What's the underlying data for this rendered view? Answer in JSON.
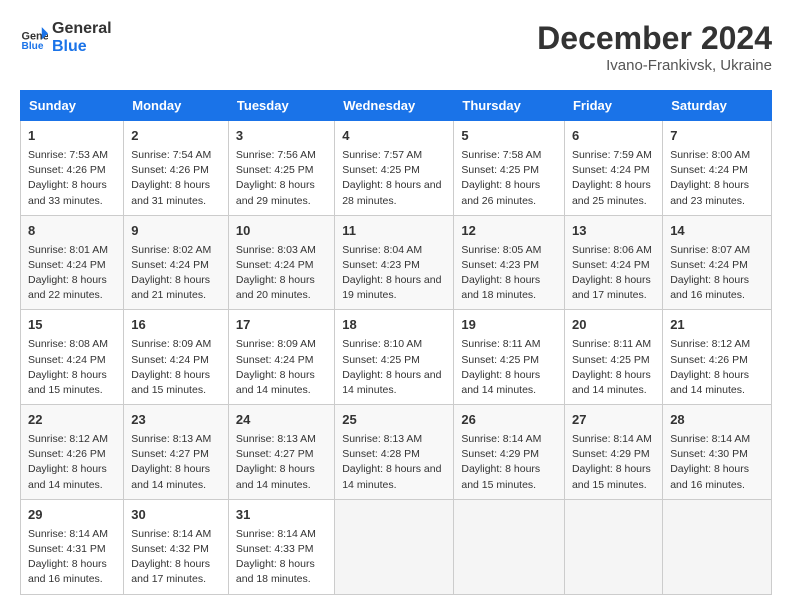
{
  "header": {
    "logo_line1": "General",
    "logo_line2": "Blue",
    "month": "December 2024",
    "location": "Ivano-Frankivsk, Ukraine"
  },
  "days_of_week": [
    "Sunday",
    "Monday",
    "Tuesday",
    "Wednesday",
    "Thursday",
    "Friday",
    "Saturday"
  ],
  "weeks": [
    [
      {
        "day": "1",
        "sunrise": "7:53 AM",
        "sunset": "4:26 PM",
        "daylight": "8 hours and 33 minutes."
      },
      {
        "day": "2",
        "sunrise": "7:54 AM",
        "sunset": "4:26 PM",
        "daylight": "8 hours and 31 minutes."
      },
      {
        "day": "3",
        "sunrise": "7:56 AM",
        "sunset": "4:25 PM",
        "daylight": "8 hours and 29 minutes."
      },
      {
        "day": "4",
        "sunrise": "7:57 AM",
        "sunset": "4:25 PM",
        "daylight": "8 hours and 28 minutes."
      },
      {
        "day": "5",
        "sunrise": "7:58 AM",
        "sunset": "4:25 PM",
        "daylight": "8 hours and 26 minutes."
      },
      {
        "day": "6",
        "sunrise": "7:59 AM",
        "sunset": "4:24 PM",
        "daylight": "8 hours and 25 minutes."
      },
      {
        "day": "7",
        "sunrise": "8:00 AM",
        "sunset": "4:24 PM",
        "daylight": "8 hours and 23 minutes."
      }
    ],
    [
      {
        "day": "8",
        "sunrise": "8:01 AM",
        "sunset": "4:24 PM",
        "daylight": "8 hours and 22 minutes."
      },
      {
        "day": "9",
        "sunrise": "8:02 AM",
        "sunset": "4:24 PM",
        "daylight": "8 hours and 21 minutes."
      },
      {
        "day": "10",
        "sunrise": "8:03 AM",
        "sunset": "4:24 PM",
        "daylight": "8 hours and 20 minutes."
      },
      {
        "day": "11",
        "sunrise": "8:04 AM",
        "sunset": "4:23 PM",
        "daylight": "8 hours and 19 minutes."
      },
      {
        "day": "12",
        "sunrise": "8:05 AM",
        "sunset": "4:23 PM",
        "daylight": "8 hours and 18 minutes."
      },
      {
        "day": "13",
        "sunrise": "8:06 AM",
        "sunset": "4:24 PM",
        "daylight": "8 hours and 17 minutes."
      },
      {
        "day": "14",
        "sunrise": "8:07 AM",
        "sunset": "4:24 PM",
        "daylight": "8 hours and 16 minutes."
      }
    ],
    [
      {
        "day": "15",
        "sunrise": "8:08 AM",
        "sunset": "4:24 PM",
        "daylight": "8 hours and 15 minutes."
      },
      {
        "day": "16",
        "sunrise": "8:09 AM",
        "sunset": "4:24 PM",
        "daylight": "8 hours and 15 minutes."
      },
      {
        "day": "17",
        "sunrise": "8:09 AM",
        "sunset": "4:24 PM",
        "daylight": "8 hours and 14 minutes."
      },
      {
        "day": "18",
        "sunrise": "8:10 AM",
        "sunset": "4:25 PM",
        "daylight": "8 hours and 14 minutes."
      },
      {
        "day": "19",
        "sunrise": "8:11 AM",
        "sunset": "4:25 PM",
        "daylight": "8 hours and 14 minutes."
      },
      {
        "day": "20",
        "sunrise": "8:11 AM",
        "sunset": "4:25 PM",
        "daylight": "8 hours and 14 minutes."
      },
      {
        "day": "21",
        "sunrise": "8:12 AM",
        "sunset": "4:26 PM",
        "daylight": "8 hours and 14 minutes."
      }
    ],
    [
      {
        "day": "22",
        "sunrise": "8:12 AM",
        "sunset": "4:26 PM",
        "daylight": "8 hours and 14 minutes."
      },
      {
        "day": "23",
        "sunrise": "8:13 AM",
        "sunset": "4:27 PM",
        "daylight": "8 hours and 14 minutes."
      },
      {
        "day": "24",
        "sunrise": "8:13 AM",
        "sunset": "4:27 PM",
        "daylight": "8 hours and 14 minutes."
      },
      {
        "day": "25",
        "sunrise": "8:13 AM",
        "sunset": "4:28 PM",
        "daylight": "8 hours and 14 minutes."
      },
      {
        "day": "26",
        "sunrise": "8:14 AM",
        "sunset": "4:29 PM",
        "daylight": "8 hours and 15 minutes."
      },
      {
        "day": "27",
        "sunrise": "8:14 AM",
        "sunset": "4:29 PM",
        "daylight": "8 hours and 15 minutes."
      },
      {
        "day": "28",
        "sunrise": "8:14 AM",
        "sunset": "4:30 PM",
        "daylight": "8 hours and 16 minutes."
      }
    ],
    [
      {
        "day": "29",
        "sunrise": "8:14 AM",
        "sunset": "4:31 PM",
        "daylight": "8 hours and 16 minutes."
      },
      {
        "day": "30",
        "sunrise": "8:14 AM",
        "sunset": "4:32 PM",
        "daylight": "8 hours and 17 minutes."
      },
      {
        "day": "31",
        "sunrise": "8:14 AM",
        "sunset": "4:33 PM",
        "daylight": "8 hours and 18 minutes."
      },
      null,
      null,
      null,
      null
    ]
  ],
  "labels": {
    "sunrise": "Sunrise:",
    "sunset": "Sunset:",
    "daylight": "Daylight:"
  }
}
